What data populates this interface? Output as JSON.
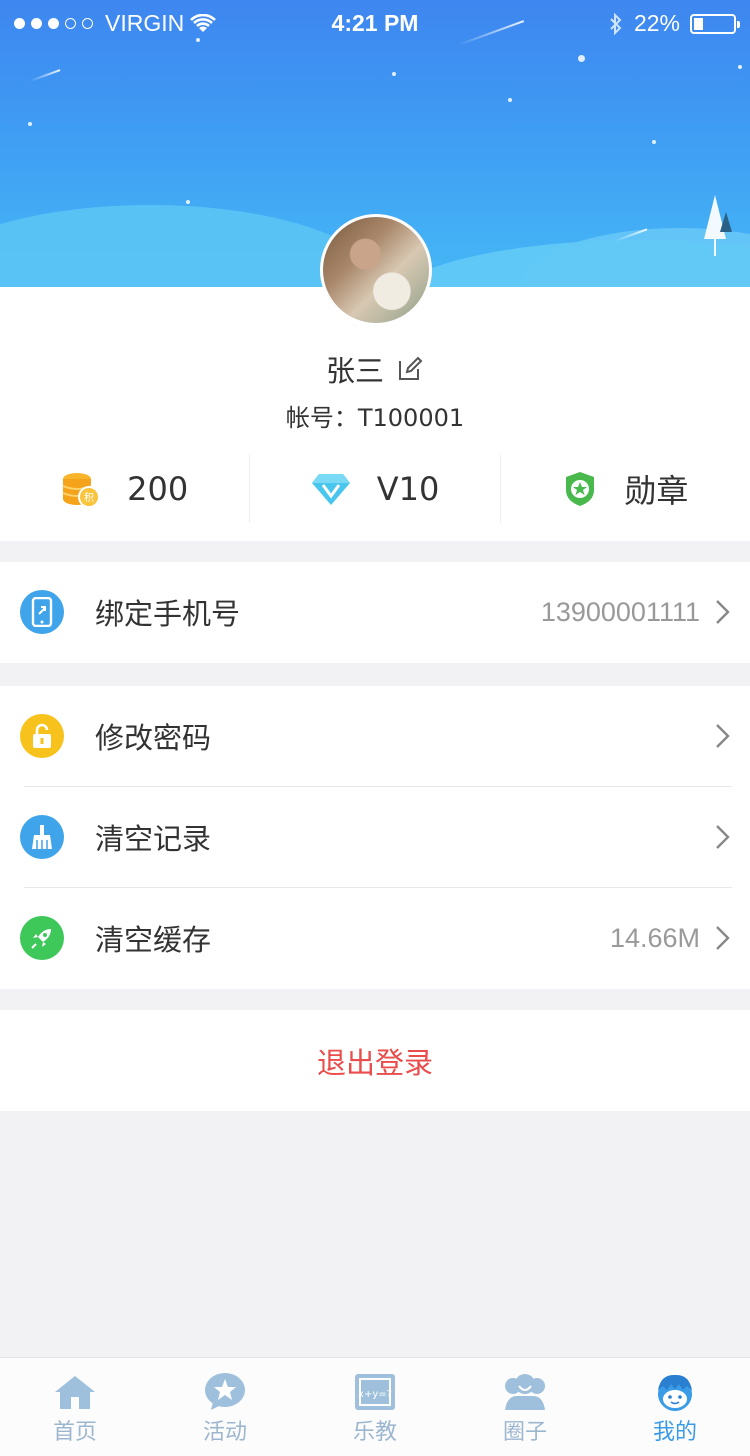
{
  "status_bar": {
    "carrier": "VIRGIN",
    "time": "4:21 PM",
    "battery": "22%"
  },
  "profile": {
    "name": "张三",
    "account": "帐号：T100001"
  },
  "stats": {
    "points": "200",
    "vip": "V10",
    "medal": "勋章"
  },
  "phone_row": {
    "label": "绑定手机号",
    "value": "13900001111"
  },
  "settings": [
    {
      "label": "修改密码",
      "value": ""
    },
    {
      "label": "清空记录",
      "value": ""
    },
    {
      "label": "清空缓存",
      "value": "14.66M"
    }
  ],
  "logout": "退出登录",
  "tabs": [
    {
      "label": "首页"
    },
    {
      "label": "活动"
    },
    {
      "label": "乐教"
    },
    {
      "label": "圈子"
    },
    {
      "label": "我的"
    }
  ],
  "colors": {
    "accent": "#3a9be6",
    "logout": "#ea4b4b",
    "phone_icon": "#3fa4ea",
    "lock_icon": "#f8c21c",
    "broom_icon": "#3fa4ea",
    "rocket_icon": "#3ec85a"
  },
  "icons": {
    "points": "coin-stack-icon",
    "vip": "diamond-icon",
    "medal": "badge-icon"
  }
}
